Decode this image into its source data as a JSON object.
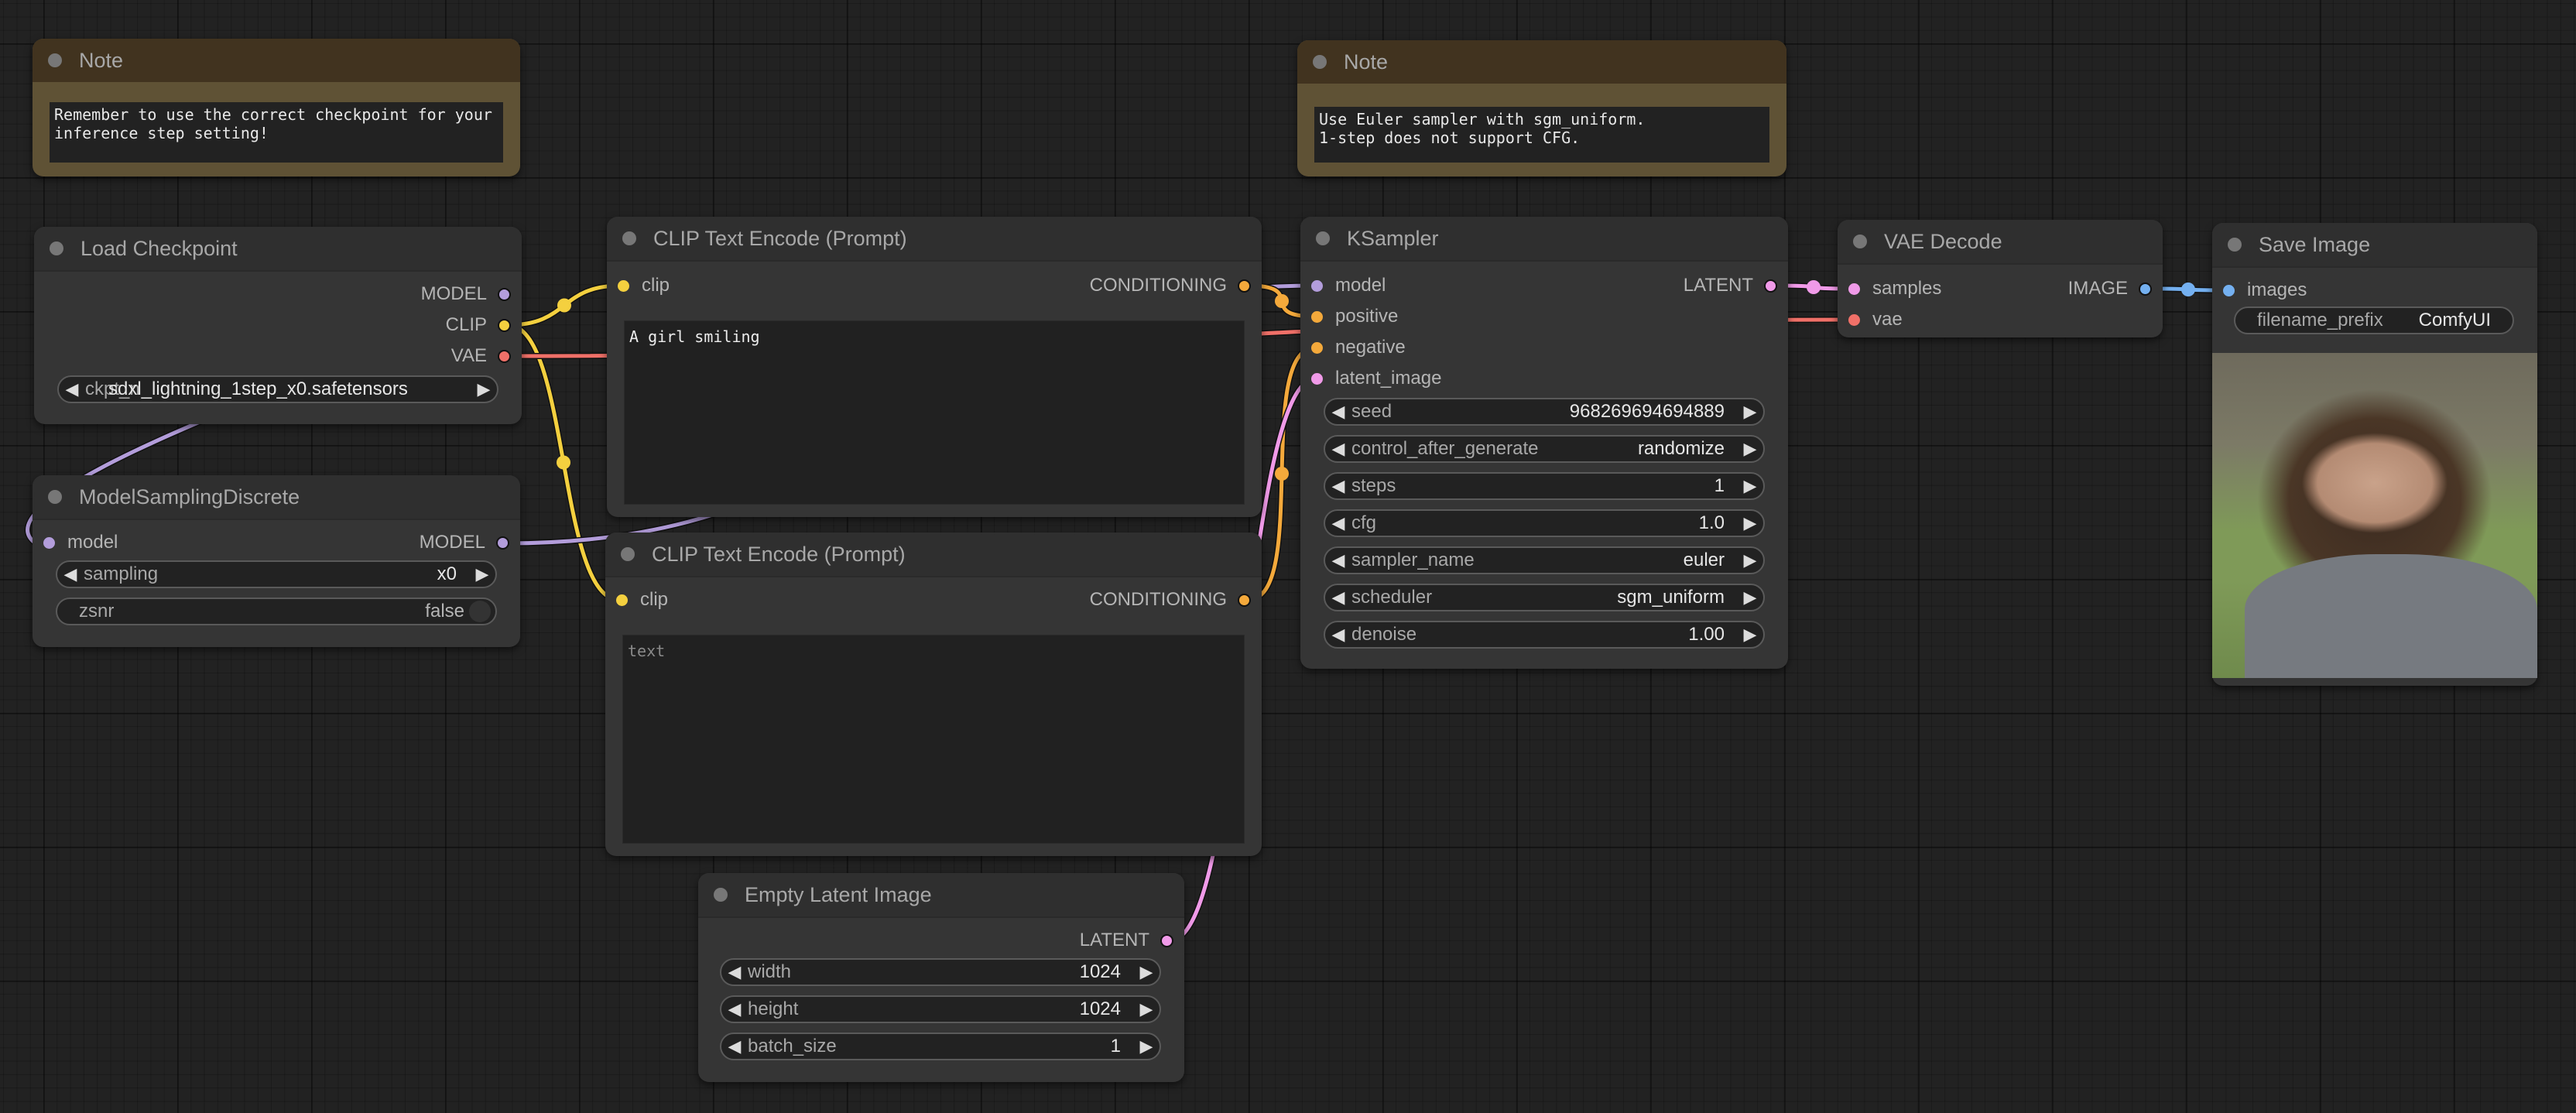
{
  "app": "ComfyUI",
  "nodes": {
    "note1": {
      "title": "Note",
      "text": "Remember to use the correct checkpoint for your\ninference step setting!"
    },
    "note2": {
      "title": "Note",
      "text": "Use Euler sampler with sgm_uniform.\n1-step does not support CFG."
    },
    "load_checkpoint": {
      "title": "Load Checkpoint",
      "outputs": [
        "MODEL",
        "CLIP",
        "VAE"
      ],
      "widgets": [
        {
          "label": "ckpt_name",
          "value": "sdxl_lightning_1step_x0.safetensors"
        }
      ]
    },
    "model_sampling": {
      "title": "ModelSamplingDiscrete",
      "inputs": [
        "model"
      ],
      "outputs": [
        "MODEL"
      ],
      "widgets": [
        {
          "label": "sampling",
          "value": "x0"
        },
        {
          "label": "zsnr",
          "value": "false"
        }
      ]
    },
    "clip_pos": {
      "title": "CLIP Text Encode (Prompt)",
      "inputs": [
        "clip"
      ],
      "outputs": [
        "CONDITIONING"
      ],
      "text": "A girl smiling"
    },
    "clip_neg": {
      "title": "CLIP Text Encode (Prompt)",
      "inputs": [
        "clip"
      ],
      "outputs": [
        "CONDITIONING"
      ],
      "text": "",
      "placeholder": "text"
    },
    "empty_latent": {
      "title": "Empty Latent Image",
      "outputs": [
        "LATENT"
      ],
      "widgets": [
        {
          "label": "width",
          "value": "1024"
        },
        {
          "label": "height",
          "value": "1024"
        },
        {
          "label": "batch_size",
          "value": "1"
        }
      ]
    },
    "ksampler": {
      "title": "KSampler",
      "inputs": [
        "model",
        "positive",
        "negative",
        "latent_image"
      ],
      "outputs": [
        "LATENT"
      ],
      "widgets": [
        {
          "label": "seed",
          "value": "968269694694889"
        },
        {
          "label": "control_after_generate",
          "value": "randomize"
        },
        {
          "label": "steps",
          "value": "1"
        },
        {
          "label": "cfg",
          "value": "1.0"
        },
        {
          "label": "sampler_name",
          "value": "euler"
        },
        {
          "label": "scheduler",
          "value": "sgm_uniform"
        },
        {
          "label": "denoise",
          "value": "1.00"
        }
      ]
    },
    "vae_decode": {
      "title": "VAE Decode",
      "inputs": [
        "samples",
        "vae"
      ],
      "outputs": [
        "IMAGE"
      ]
    },
    "save_image": {
      "title": "Save Image",
      "inputs": [
        "images"
      ],
      "widgets": [
        {
          "label": "filename_prefix",
          "value": "ComfyUI"
        }
      ],
      "preview": "generated image: smiling woman with long brown hair, grey shirt, outdoor green background"
    }
  },
  "type_colors": {
    "MODEL": "#b39ddb",
    "CLIP": "#f4d03f",
    "VAE": "#f07068",
    "CONDITIONING": "#f4a93b",
    "LATENT": "#f09ae8",
    "IMAGE": "#74b0f0"
  },
  "icons": {
    "left_arrow": "◀",
    "right_arrow": "▶"
  }
}
